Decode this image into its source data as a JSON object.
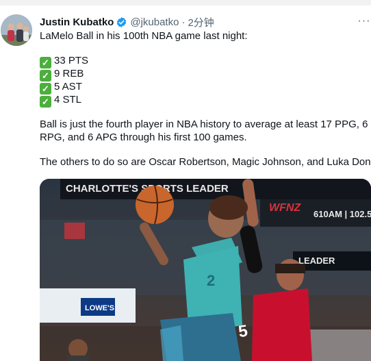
{
  "tweet": {
    "author_name": "Justin Kubatko",
    "handle": "@jkubatko",
    "separator": "·",
    "time": "2分钟",
    "more_label": "···",
    "intro": "LaMelo Ball in his 100th NBA game last night:",
    "stats": [
      {
        "check": "✓",
        "label": "33 PTS"
      },
      {
        "check": "✓",
        "label": "9 REB"
      },
      {
        "check": "✓",
        "label": "5 AST"
      },
      {
        "check": "✓",
        "label": "4 STL"
      }
    ],
    "paragraph2_line1": "Ball is just the fourth player in NBA history to average at least 17 PPG, 6",
    "paragraph2_line2": "RPG, and 6 APG through his first 100 games.",
    "paragraph3": "The others to do so are Oscar Robertson, Magic Johnson, and Luka Doncic."
  },
  "media": {
    "banner_text": "CHARLOTTE'S SPORTS LEADER",
    "station": "WFNZ",
    "frequency": "610AM | 102.5",
    "sponsor": "LOWE'S",
    "right_banner": "LEADER",
    "jersey_home_number": "2",
    "jersey_away_number": "5"
  },
  "colors": {
    "verified": "#1d9bf0",
    "check": "#4caf3d",
    "hornets_teal": "#3fb2b3",
    "bulls_red": "#c8102e"
  }
}
